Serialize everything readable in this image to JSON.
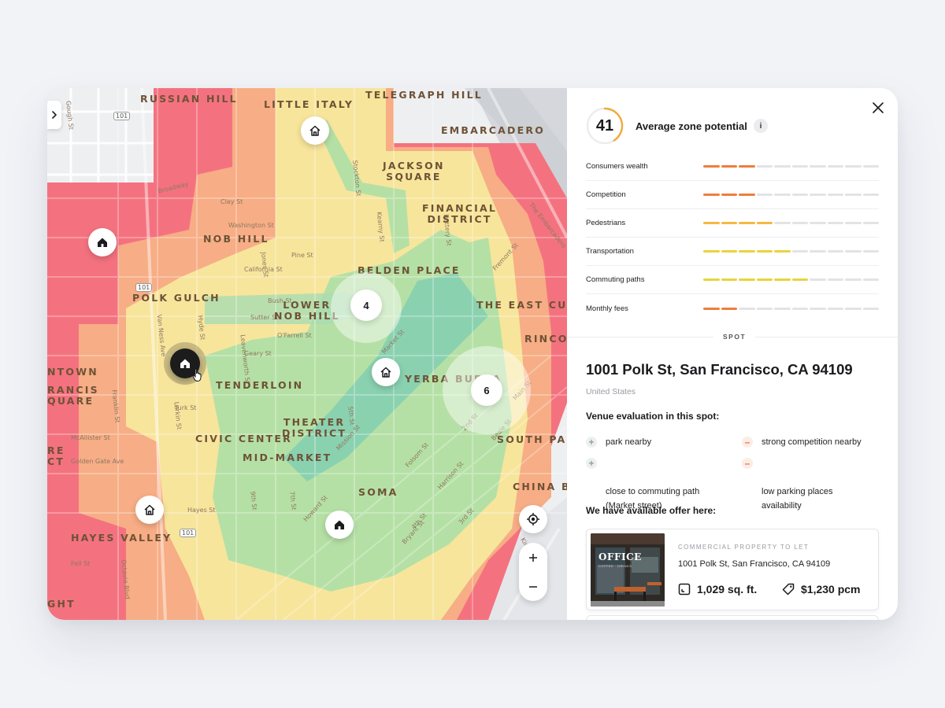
{
  "map": {
    "districts": [
      {
        "id": "russian-hill",
        "name": "RUSSIAN HILL"
      },
      {
        "id": "little-italy",
        "name": "LITTLE ITALY"
      },
      {
        "id": "telegraph-hill",
        "name": "TELEGRAPH HILL"
      },
      {
        "id": "embarcadero",
        "name": "EMBARCADERO"
      },
      {
        "id": "jackson-square",
        "name": "JACKSON\nSQUARE"
      },
      {
        "id": "financial-district",
        "name": "FINANCIAL\nDISTRICT"
      },
      {
        "id": "nob-hill",
        "name": "NOB HILL"
      },
      {
        "id": "belden-place",
        "name": "BELDEN PLACE"
      },
      {
        "id": "polk-gulch",
        "name": "POLK GULCH"
      },
      {
        "id": "lower-nob-hill",
        "name": "LOWER\nNOB HILL"
      },
      {
        "id": "the-east-cut",
        "name": "THE EAST CUT"
      },
      {
        "id": "rincon",
        "name": "RINCON"
      },
      {
        "id": "ntown",
        "name": "NTOWN"
      },
      {
        "id": "rancis-quare",
        "name": "RANCIS\nQUARE"
      },
      {
        "id": "tenderloin",
        "name": "TENDERLOIN"
      },
      {
        "id": "yerba-buena",
        "name": "YERBA BUENA"
      },
      {
        "id": "theater-district",
        "name": "THEATER\nDISTRICT"
      },
      {
        "id": "civic-center",
        "name": "CIVIC CENTER"
      },
      {
        "id": "re-ct",
        "name": "RE\nCT"
      },
      {
        "id": "mid-market",
        "name": "MID-MARKET"
      },
      {
        "id": "south-park",
        "name": "SOUTH PARK"
      },
      {
        "id": "soma",
        "name": "SOMA"
      },
      {
        "id": "china-ba",
        "name": "CHINA BA"
      },
      {
        "id": "hayes-valley",
        "name": "HAYES VALLEY"
      },
      {
        "id": "ght",
        "name": "GHT"
      }
    ],
    "streets": [
      {
        "id": "broadway",
        "name": "Broadway"
      },
      {
        "id": "clay",
        "name": "Clay St"
      },
      {
        "id": "california",
        "name": "California St"
      },
      {
        "id": "bush",
        "name": "Bush St"
      },
      {
        "id": "sutter",
        "name": "Sutter St"
      },
      {
        "id": "geary",
        "name": "Geary St"
      },
      {
        "id": "turk",
        "name": "Turk St"
      },
      {
        "id": "golden-gate",
        "name": "Golden Gate Ave"
      },
      {
        "id": "hayes",
        "name": "Hayes St"
      },
      {
        "id": "market",
        "name": "Market St"
      },
      {
        "id": "mission",
        "name": "Mission St"
      },
      {
        "id": "howard",
        "name": "Howard St"
      },
      {
        "id": "folsom",
        "name": "Folsom St"
      },
      {
        "id": "harrison",
        "name": "Harrison St"
      },
      {
        "id": "bryant",
        "name": "Bryant St"
      },
      {
        "id": "van-ness",
        "name": "Van Ness Ave"
      },
      {
        "id": "franklin",
        "name": "Franklin St"
      },
      {
        "id": "larkin",
        "name": "Larkin St"
      },
      {
        "id": "hyde",
        "name": "Hyde St"
      },
      {
        "id": "leavenworth",
        "name": "Leavenworth St"
      },
      {
        "id": "jones",
        "name": "Jones St"
      },
      {
        "id": "kearny",
        "name": "Kearny St"
      },
      {
        "id": "battery",
        "name": "Battery St"
      },
      {
        "id": "5th",
        "name": "5th St"
      },
      {
        "id": "7th",
        "name": "7th St"
      },
      {
        "id": "9th",
        "name": "9th St"
      },
      {
        "id": "4th",
        "name": "4th St"
      },
      {
        "id": "2nd",
        "name": "2nd St"
      },
      {
        "id": "pine",
        "name": "Pine St"
      },
      {
        "id": "ofarrell",
        "name": "O'Farrell St"
      },
      {
        "id": "mcallister",
        "name": "McAllister St"
      },
      {
        "id": "fell",
        "name": "Fell St"
      },
      {
        "id": "gough",
        "name": "Gough St"
      },
      {
        "id": "octavia",
        "name": "Octavia Blvd"
      },
      {
        "id": "stockton",
        "name": "Stockton St"
      },
      {
        "id": "beale",
        "name": "Beale St"
      },
      {
        "id": "main",
        "name": "Main St"
      },
      {
        "id": "fremont",
        "name": "Fremont St"
      },
      {
        "id": "the-embarcadero",
        "name": "The Embarcadero"
      },
      {
        "id": "king",
        "name": "King St"
      },
      {
        "id": "3rd",
        "name": "3rd St"
      },
      {
        "id": "wash",
        "name": "Washington St"
      }
    ],
    "highway_shields": [
      "101",
      "101",
      "101"
    ],
    "clusters": [
      {
        "id": "cluster-4",
        "count": "4"
      },
      {
        "id": "cluster-6",
        "count": "6"
      }
    ],
    "colors": {
      "red": "#f4727f",
      "orange": "#f7ad85",
      "yellow": "#f7e59c",
      "green": "#b5e0a5",
      "teal": "#8ad1b0"
    }
  },
  "panel": {
    "score": "41",
    "score_fraction": 0.41,
    "score_color": "#f3a93c",
    "title": "Average zone potential",
    "info_label": "i",
    "metrics": [
      {
        "label": "Consumers wealth",
        "filled": 3,
        "total": 10,
        "color": "#ef7d3c"
      },
      {
        "label": "Competition",
        "filled": 3,
        "total": 10,
        "color": "#ef7d3c"
      },
      {
        "label": "Pedestrians",
        "filled": 4,
        "total": 10,
        "color": "#f5b840"
      },
      {
        "label": "Transportation",
        "filled": 5,
        "total": 10,
        "color": "#e8d43e"
      },
      {
        "label": "Commuting paths",
        "filled": 6,
        "total": 10,
        "color": "#e8d43e"
      },
      {
        "label": "Monthly fees",
        "filled": 2,
        "total": 10,
        "color": "#ef7d3c"
      }
    ],
    "spot_label": "SPOT",
    "address": "1001 Polk St, San Francisco, CA 94109",
    "country": "United States",
    "evaluation_title": "Venue evaluation in this spot:",
    "pros": [
      "park nearby",
      "close to commuting path\n(Market street)"
    ],
    "cons": [
      "strong competition nearby",
      "low parking places\navailability"
    ],
    "plus_symbol": "+",
    "minus_symbol": "–",
    "offer_title": "We have available offer here:",
    "offer": {
      "tag": "COMMERCIAL PROPERTY TO LET",
      "address": "1001 Polk St, San Francisco, CA 94109",
      "size": "1,029 sq. ft.",
      "price": "$1,230 pcm",
      "image_sign": "OFFICE",
      "image_subsign": "COFFEE · DRINKS"
    }
  }
}
